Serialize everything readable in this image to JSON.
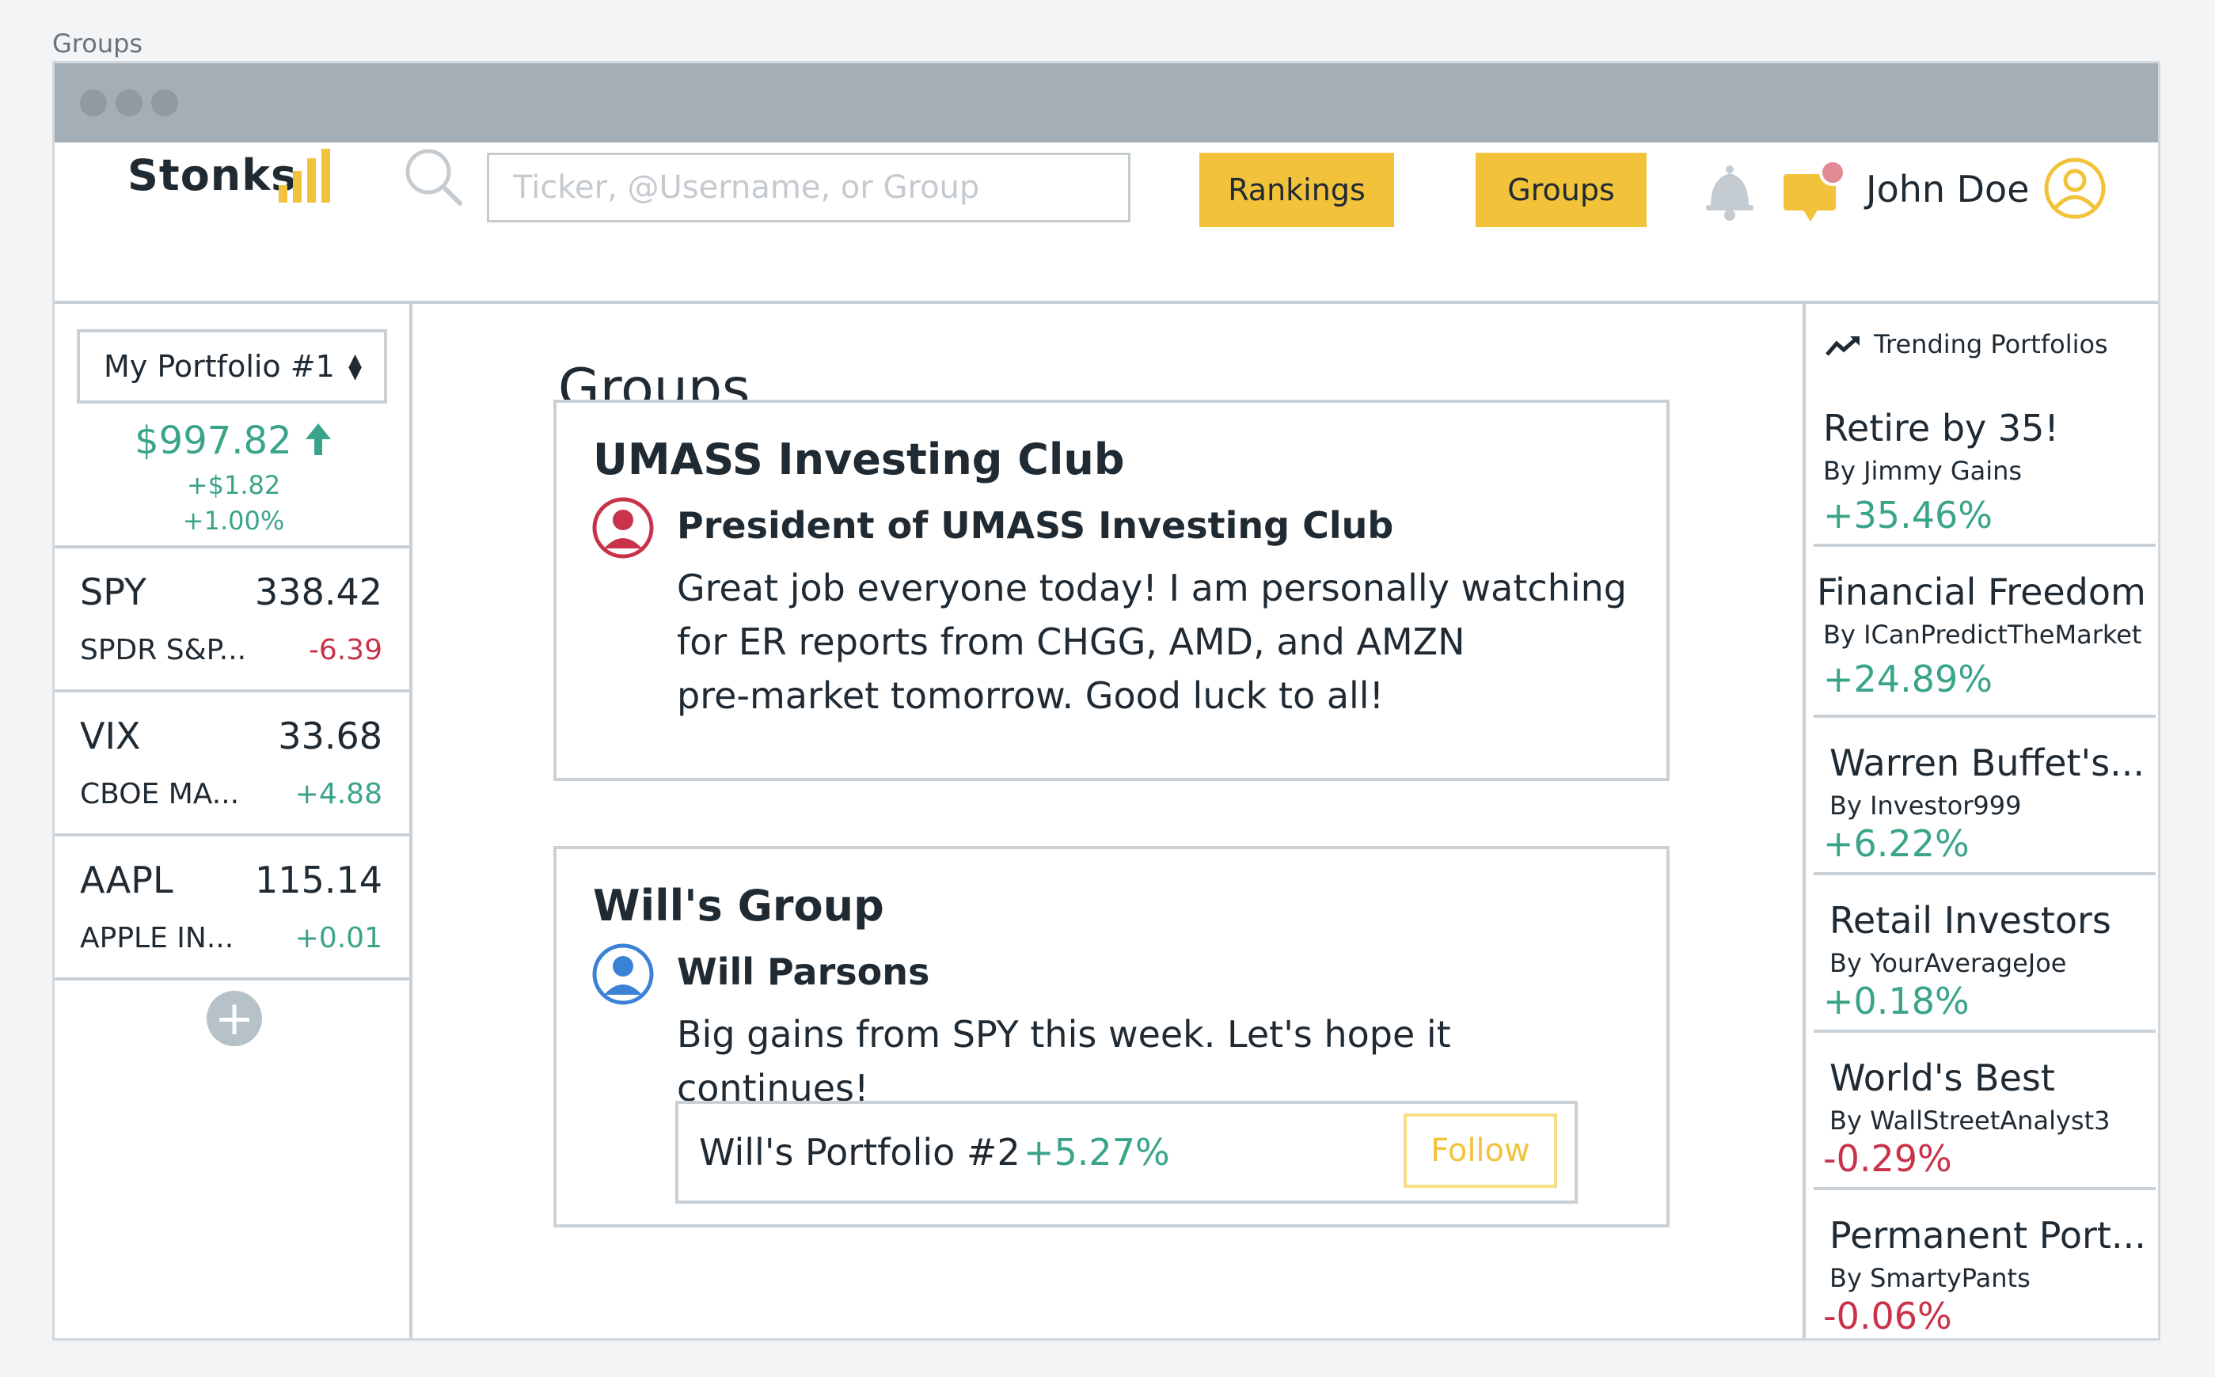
{
  "page_label": "Groups",
  "colors": {
    "accent": "#f2c23a",
    "positive": "#3aa48a",
    "negative": "#c8334a",
    "border": "#c9d1d7"
  },
  "header": {
    "logo": "Stonks",
    "search_placeholder": "Ticker, @Username, or Group",
    "nav": {
      "rankings": "Rankings",
      "groups": "Groups"
    },
    "user_name": "John Doe",
    "icons": [
      "search-icon",
      "bell-icon",
      "chat-icon",
      "user-avatar-icon"
    ]
  },
  "portfolio": {
    "selected": "My Portfolio #1",
    "value": "$997.82",
    "change_abs": "+$1.82",
    "change_pct": "+1.00%"
  },
  "watchlist": [
    {
      "symbol": "SPY",
      "price": "338.42",
      "name": "SPDR S&P...",
      "change": "-6.39"
    },
    {
      "symbol": "VIX",
      "price": "33.68",
      "name": "CBOE MA...",
      "change": "+4.88"
    },
    {
      "symbol": "AAPL",
      "price": "115.14",
      "name": "APPLE IN...",
      "change": "+0.01"
    }
  ],
  "main": {
    "title": "Groups",
    "groups": [
      {
        "name": "UMASS Investing Club",
        "author": "President of UMASS Investing Club",
        "message_lines": [
          "Great job everyone today! I am personally watching",
          "for ER reports from CHGG, AMD, and AMZN",
          "pre-market tomorrow. Good luck to all!"
        ]
      },
      {
        "name": "Will's Group",
        "author": "Will Parsons",
        "message_lines": [
          "Big gains from SPY this week. Let's hope it continues!"
        ],
        "shared_portfolio": {
          "name": "Will's Portfolio #2",
          "pct": "+5.27%",
          "action": "Follow"
        }
      }
    ]
  },
  "trending": {
    "heading": "Trending Portfolios",
    "items": [
      {
        "name": "Retire by 35!",
        "by": "By Jimmy Gains",
        "pct": "+35.46%"
      },
      {
        "name": "Financial Freedom",
        "by": "By ICanPredictTheMarket",
        "pct": "+24.89%"
      },
      {
        "name": "Warren Buffet's...",
        "by": "By Investor999",
        "pct": "+6.22%"
      },
      {
        "name": "Retail Investors",
        "by": "By YourAverageJoe",
        "pct": "+0.18%"
      },
      {
        "name": "World's Best",
        "by": "By WallStreetAnalyst3",
        "pct": "-0.29%"
      },
      {
        "name": "Permanent Port...",
        "by": "By SmartyPants",
        "pct": "-0.06%"
      }
    ]
  }
}
